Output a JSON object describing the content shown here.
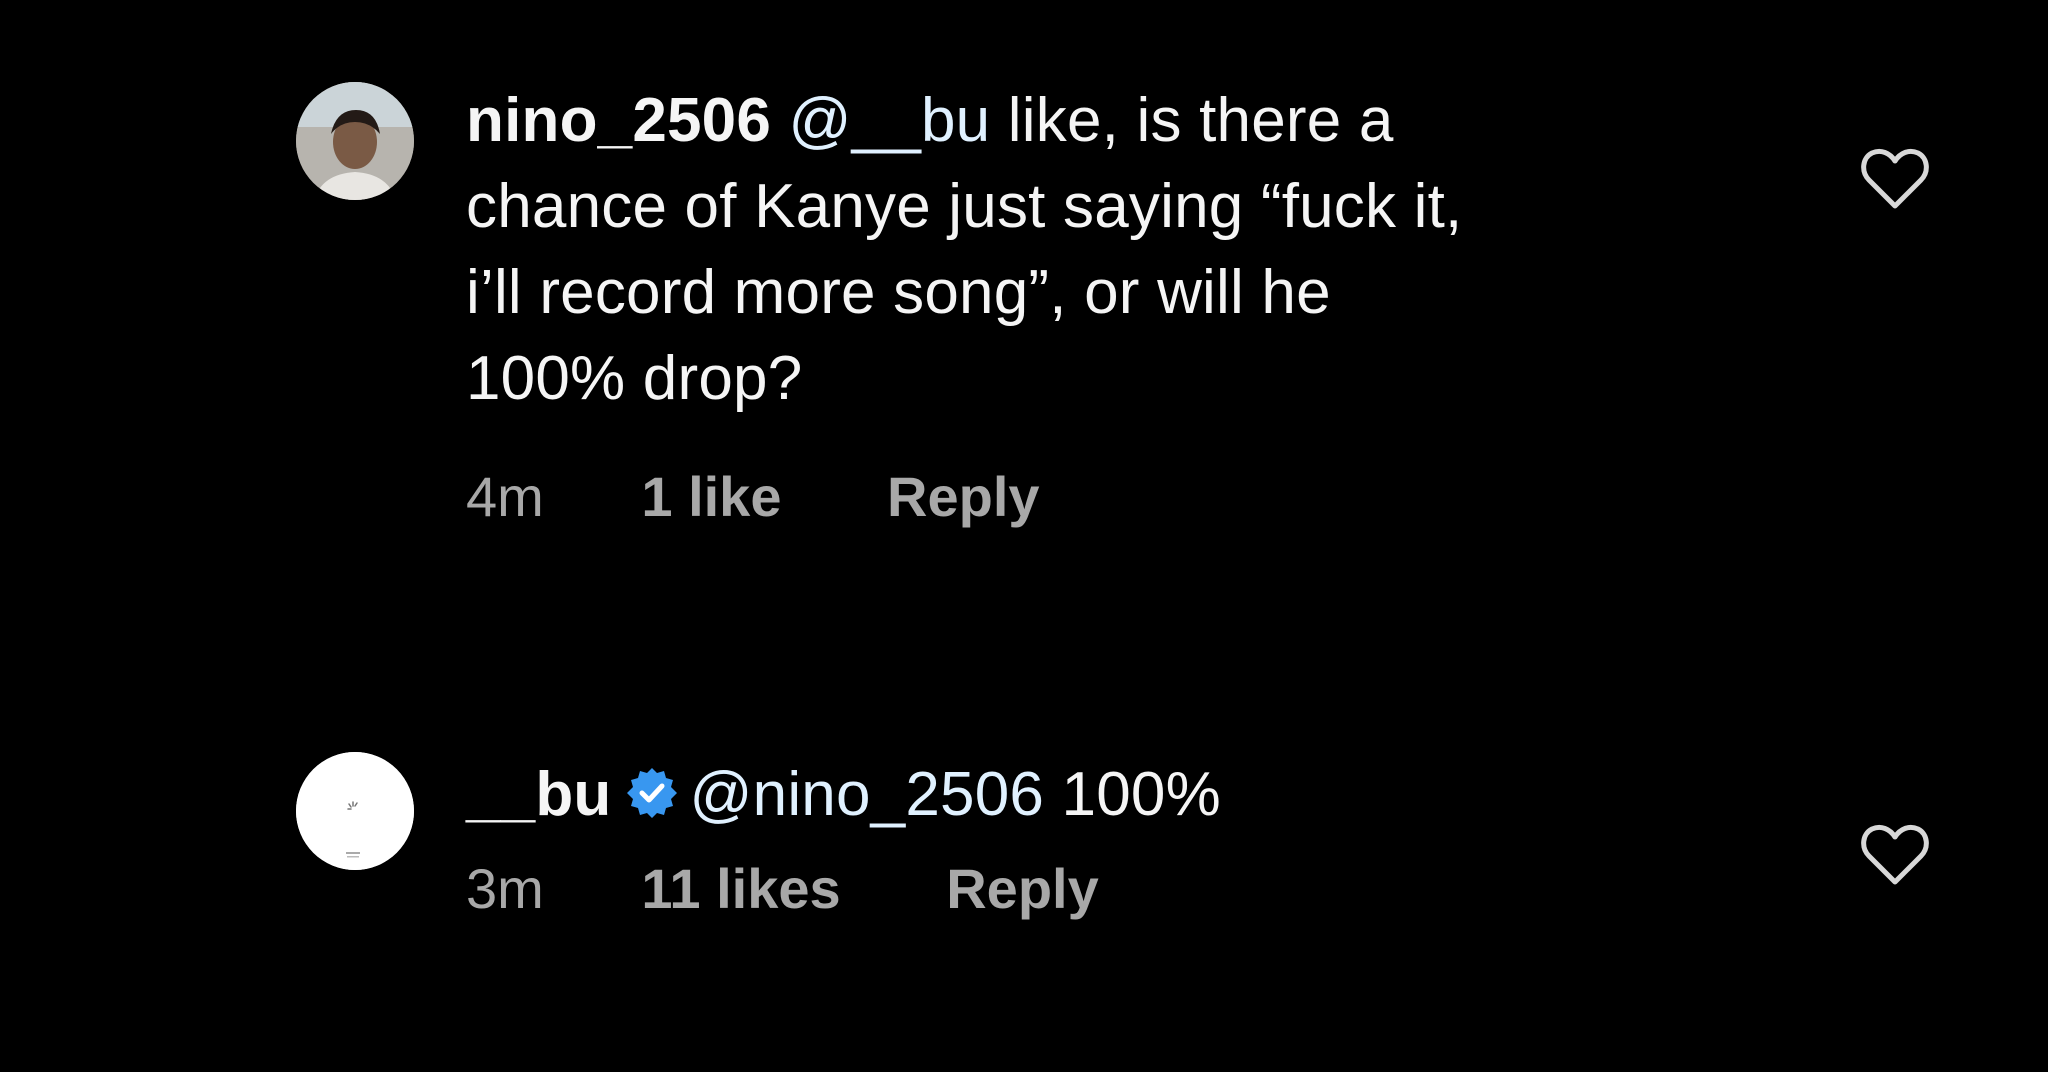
{
  "comments": [
    {
      "username": "nino_2506",
      "mention": "@__bu",
      "text_lines": [
        " like, is there a",
        "chance of Kanye just saying “fuck it,",
        "i’ll record more song”, or will he",
        "100% drop?"
      ],
      "time": "4m",
      "likes": "1 like",
      "reply_label": "Reply",
      "avatar": "user-photo",
      "heart_icon": "heart-outline-icon"
    },
    {
      "username": "__bu",
      "verified_icon": "verified-badge-icon",
      "mention": "@nino_2506",
      "text": " 100%",
      "time": "3m",
      "likes": "11 likes",
      "reply_label": "Reply",
      "avatar": "white-logo",
      "heart_icon": "heart-outline-icon"
    }
  ],
  "colors": {
    "background": "#000000",
    "text": "#f5f5f5",
    "mention": "#e0f1ff",
    "meta": "#a8a8a8",
    "verified": "#3897f0"
  }
}
